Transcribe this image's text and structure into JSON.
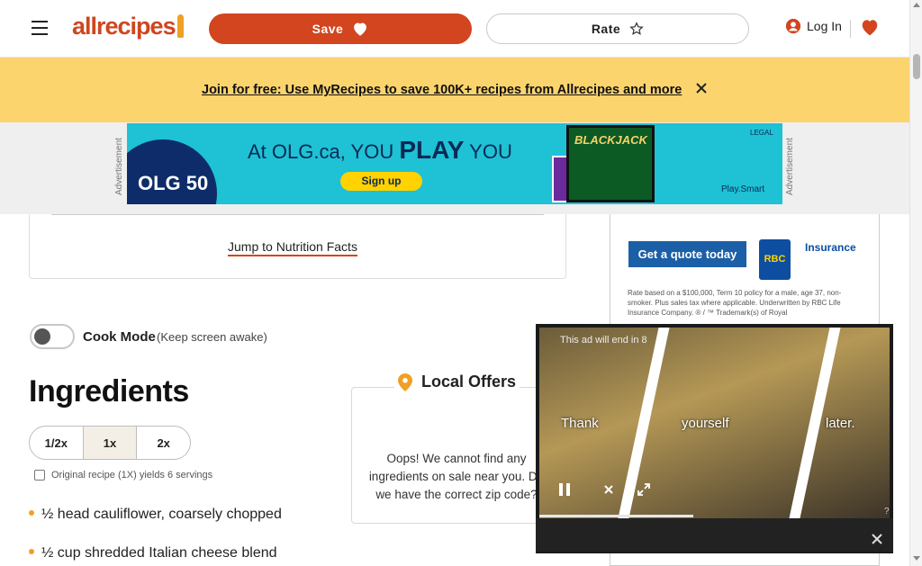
{
  "header": {
    "logo_text": "allrecipes",
    "save_label": "Save",
    "rate_label": "Rate",
    "login_label": "Log In",
    "icons": [
      "menu-icon",
      "heart-icon",
      "star-icon",
      "user-icon",
      "saved-heart-icon"
    ]
  },
  "promo": {
    "link_text": "Join for free: Use MyRecipes to save 100K+ recipes from Allrecipes and more"
  },
  "top_ad": {
    "side_label": "Advertisement",
    "headline_pre": "At OLG.ca, YOU ",
    "headline_bold": "PLAY",
    "headline_post": " YOU",
    "signup": "Sign up",
    "logo_text": "OLG 50",
    "blackjack": "BLACKJACK",
    "brand": "Play.Smart",
    "legal": "LEGAL"
  },
  "recipe": {
    "jump_link": "Jump to Nutrition Facts",
    "cook_mode_label": "Cook Mode",
    "cook_mode_sub": "(Keep screen awake)",
    "ingredients_title": "Ingredients",
    "scale_options": [
      "1/2x",
      "1x",
      "2x"
    ],
    "scale_active": "1x",
    "yield_text": "Original recipe (1X) yields 6 servings",
    "ingredients": [
      "½ head cauliflower, coarsely chopped",
      "½ cup shredded Italian cheese blend"
    ]
  },
  "local_offers": {
    "title": "Local Offers",
    "body": "Oops! We cannot find any ingredients on sale near you. Do we have the correct zip code?"
  },
  "right_ad": {
    "cta": "Get a quote today",
    "logo": "RBC",
    "product": "Insurance",
    "fine_print": "Rate based on a $100,000, Term 10 policy for a male, age 37, non-smoker. Plus sales tax where applicable. Underwritten by RBC Life Insurance Company. ® / ™ Trademark(s) of Royal"
  },
  "video_ad": {
    "countdown": "This ad will end in 8",
    "words": [
      "Thank",
      "yourself",
      "later."
    ],
    "progress": 0.44,
    "help": "?"
  },
  "colors": {
    "brand_orange": "#d2451e",
    "promo_yellow": "#fbd46e",
    "accent_gold": "#f0a024"
  }
}
